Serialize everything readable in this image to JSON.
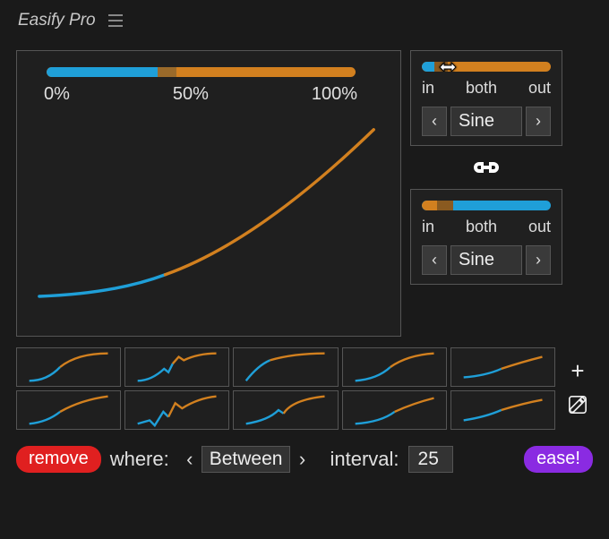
{
  "header": {
    "title": "Easify Pro"
  },
  "graph": {
    "pct_labels": [
      "0%",
      "50%",
      "100%"
    ],
    "bar_split": 36
  },
  "chart_data": {
    "type": "line",
    "title": "",
    "xlabel": "",
    "ylabel": "",
    "xlim": [
      0,
      100
    ],
    "ylim": [
      0,
      100
    ],
    "series": [
      {
        "name": "in",
        "color": "#1f9fd8",
        "x": [
          0,
          10,
          20,
          30,
          36
        ],
        "y": [
          14,
          15,
          17,
          20,
          23
        ]
      },
      {
        "name": "out",
        "color": "#d2801f",
        "x": [
          36,
          50,
          60,
          70,
          80,
          90,
          100
        ],
        "y": [
          23,
          31,
          39,
          49,
          61,
          77,
          95
        ]
      }
    ]
  },
  "ease_in": {
    "labels": [
      "in",
      "both",
      "out"
    ],
    "curve": "Sine"
  },
  "ease_out": {
    "labels": [
      "in",
      "both",
      "out"
    ],
    "curve": "Sine"
  },
  "presets": {
    "count": 10
  },
  "bottom": {
    "remove_label": "remove",
    "where_label": "where:",
    "where_value": "Between",
    "interval_label": "interval:",
    "interval_value": "25",
    "ease_label": "ease!"
  }
}
